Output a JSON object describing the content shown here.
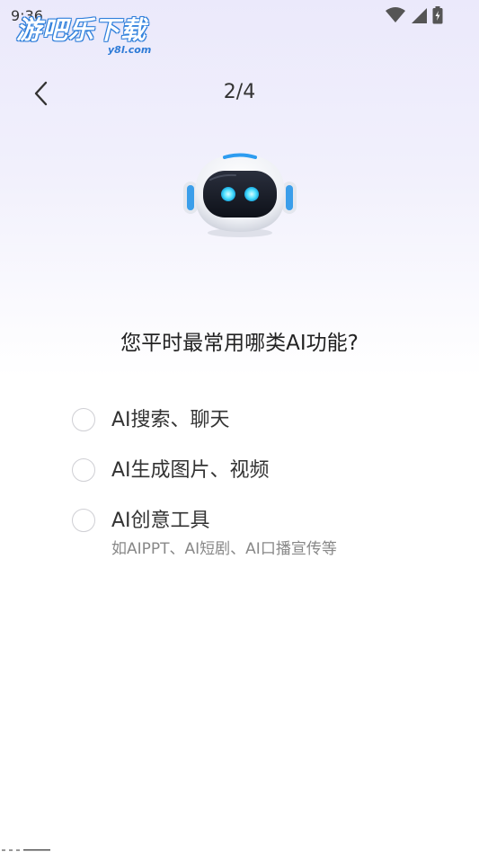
{
  "status_bar": {
    "time": "9:36",
    "icons": [
      "wifi-icon",
      "signal-icon",
      "battery-icon"
    ]
  },
  "watermark": {
    "main": "游吧乐下载",
    "sub": "y8l.com"
  },
  "header": {
    "back_icon": "chevron-left-icon",
    "step": "2/4"
  },
  "question": "您平时最常用哪类AI功能?",
  "options": [
    {
      "label": "AI搜索、聊天",
      "desc": ""
    },
    {
      "label": "AI生成图片、视频",
      "desc": ""
    },
    {
      "label": "AI创意工具",
      "desc": "如AIPPT、AI短剧、AI口播宣传等"
    }
  ],
  "colors": {
    "accent": "#2d9cf0",
    "background_top": "#ebe9fb",
    "text_primary": "#333333",
    "text_secondary": "#888888",
    "radio_border": "#cfcfd4"
  }
}
